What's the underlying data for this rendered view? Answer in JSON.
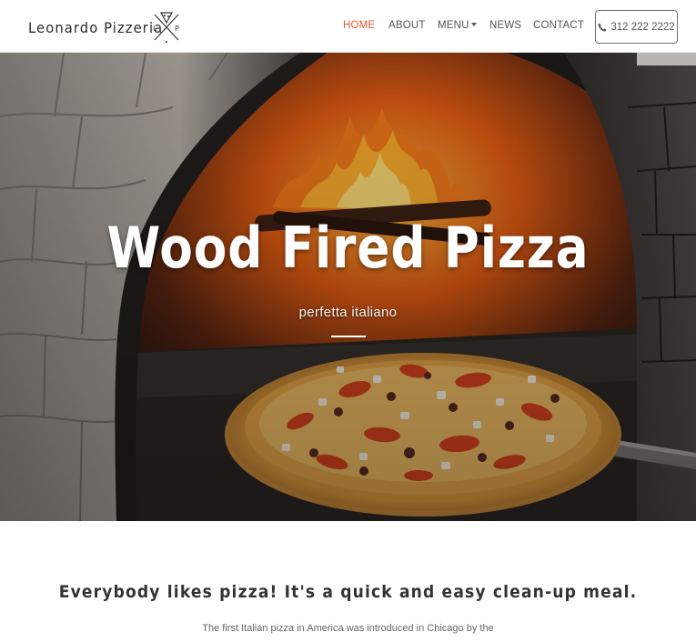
{
  "brand": {
    "name": "Leonardo Pizzeria",
    "logo_letters": [
      "L",
      "P"
    ]
  },
  "nav": {
    "items": [
      {
        "label": "HOME",
        "active": true
      },
      {
        "label": "ABOUT",
        "active": false
      },
      {
        "label": "MENU",
        "active": false,
        "dropdown": true
      },
      {
        "label": "NEWS",
        "active": false
      },
      {
        "label": "CONTACT",
        "active": false
      }
    ],
    "phone": "312 222 2222",
    "phone_icon": "phone-icon"
  },
  "hero": {
    "title": "Wood Fired Pizza",
    "subtitle": "perfetta italiano",
    "background": "wood-fired-oven-with-pizza"
  },
  "content": {
    "heading": "Everybody likes pizza! It's a quick and easy clean-up meal.",
    "paragraph": "The first Italian pizza in America was introduced in Chicago by the"
  },
  "colors": {
    "accent": "#e5562b",
    "nav_text": "#555555",
    "heading": "#333333"
  }
}
